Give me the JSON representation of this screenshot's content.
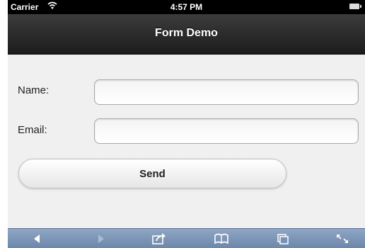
{
  "statusbar": {
    "carrier": "Carrier",
    "time": "4:57 PM"
  },
  "header": {
    "title": "Form Demo"
  },
  "form": {
    "name_label": "Name:",
    "name_value": "",
    "email_label": "Email:",
    "email_value": "",
    "send_label": "Send"
  },
  "toolbar": {
    "icons": [
      "back-icon",
      "forward-icon",
      "share-icon",
      "bookmarks-icon",
      "tabs-icon",
      "fullscreen-icon"
    ]
  }
}
